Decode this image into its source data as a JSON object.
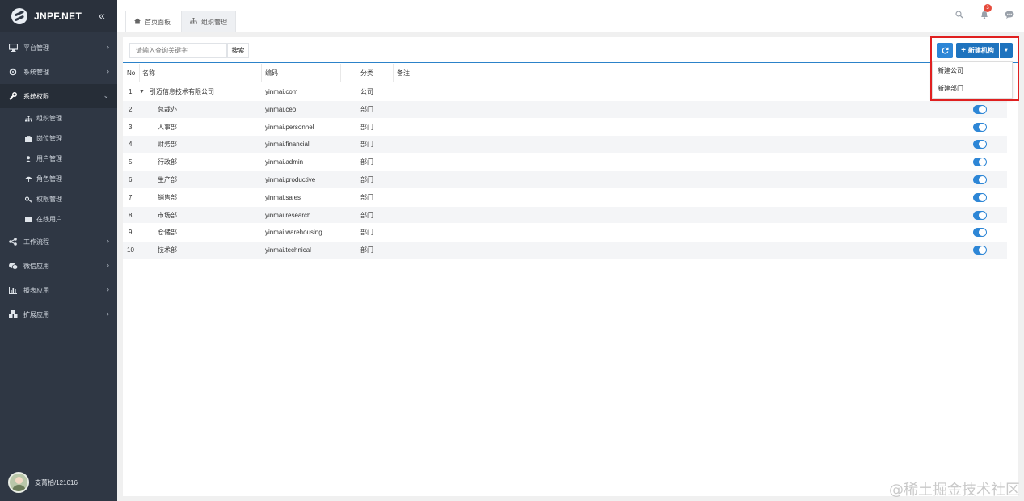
{
  "app": {
    "logo": "JNPF.NET",
    "collapse_icon": "double-chevron-left-icon"
  },
  "sidebar": {
    "menu": [
      {
        "label": "平台管理",
        "icon": "monitor-icon"
      },
      {
        "label": "系统管理",
        "icon": "gear-icon"
      },
      {
        "label": "系统权限",
        "icon": "wrench-icon",
        "active": true
      }
    ],
    "submenu": [
      {
        "label": "组织管理",
        "icon": "org-chart-icon"
      },
      {
        "label": "岗位管理",
        "icon": "briefcase-icon"
      },
      {
        "label": "用户管理",
        "icon": "user-icon"
      },
      {
        "label": "角色管理",
        "icon": "umbrella-icon"
      },
      {
        "label": "权限管理",
        "icon": "key-icon"
      },
      {
        "label": "在线用户",
        "icon": "keyboard-icon"
      }
    ],
    "menu_after": [
      {
        "label": "工作流程",
        "icon": "share-icon"
      },
      {
        "label": "微信应用",
        "icon": "wechat-icon"
      },
      {
        "label": "报表应用",
        "icon": "bar-chart-icon"
      },
      {
        "label": "扩展应用",
        "icon": "cubes-icon"
      }
    ],
    "user": "支菁柏/121016"
  },
  "tabs": [
    {
      "label": "首页面板",
      "icon": "home-icon"
    },
    {
      "label": "组织管理",
      "icon": "org-chart-icon"
    }
  ],
  "header": {
    "notification_count": "3"
  },
  "toolbar": {
    "search_placeholder": "请输入查询关键字",
    "search_label": "搜索",
    "new_label": "新建机构",
    "dropdown": [
      "新建公司",
      "新建部门"
    ]
  },
  "table": {
    "columns": {
      "no": "No",
      "name": "名称",
      "code": "编码",
      "category": "分类",
      "remark": "备注"
    },
    "rows": [
      {
        "no": "1",
        "name": "引迈信息技术有限公司",
        "code": "yinmai.com",
        "category": "公司",
        "expandable": true
      },
      {
        "no": "2",
        "name": "总裁办",
        "code": "yinmai.ceo",
        "category": "部门"
      },
      {
        "no": "3",
        "name": "人事部",
        "code": "yinmai.personnel",
        "category": "部门"
      },
      {
        "no": "4",
        "name": "财务部",
        "code": "yinmai.financial",
        "category": "部门"
      },
      {
        "no": "5",
        "name": "行政部",
        "code": "yinmai.admin",
        "category": "部门"
      },
      {
        "no": "6",
        "name": "生产部",
        "code": "yinmai.productive",
        "category": "部门"
      },
      {
        "no": "7",
        "name": "销售部",
        "code": "yinmai.sales",
        "category": "部门"
      },
      {
        "no": "8",
        "name": "市场部",
        "code": "yinmai.research",
        "category": "部门"
      },
      {
        "no": "9",
        "name": "仓储部",
        "code": "yinmai.warehousing",
        "category": "部门"
      },
      {
        "no": "10",
        "name": "技术部",
        "code": "yinmai.technical",
        "category": "部门"
      }
    ]
  },
  "watermark": "@稀土掘金技术社区",
  "colors": {
    "sidebar": "#2f3744",
    "accent": "#1e73be",
    "toggle": "#2d86d6",
    "highlight": "#e02020",
    "badge": "#e64b3c"
  }
}
